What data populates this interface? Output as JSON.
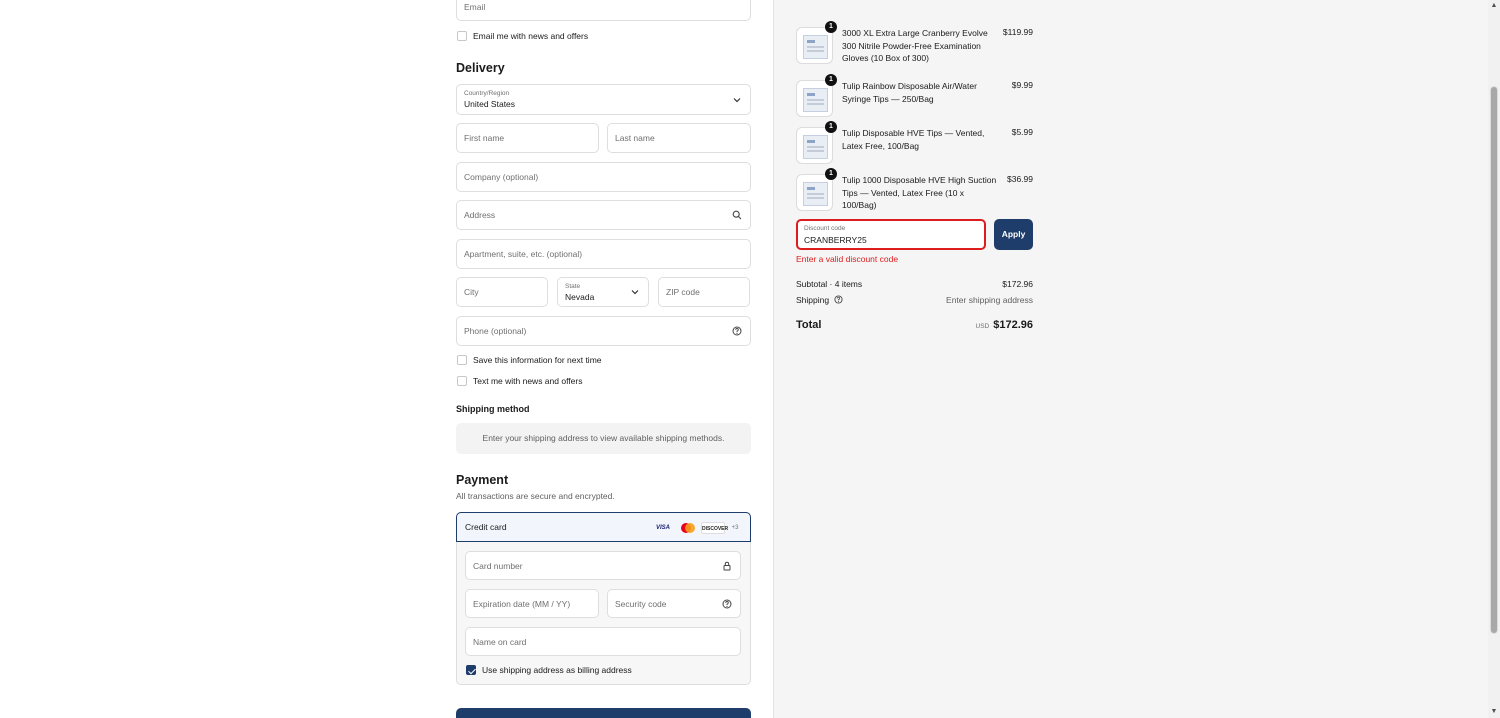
{
  "contact": {
    "email_placeholder": "Email",
    "news_label": "Email me with news and offers"
  },
  "delivery": {
    "heading": "Delivery",
    "country_label": "Country/Region",
    "country_value": "United States",
    "first_name_placeholder": "First name",
    "last_name_placeholder": "Last name",
    "company_placeholder": "Company (optional)",
    "address_placeholder": "Address",
    "apartment_placeholder": "Apartment, suite, etc. (optional)",
    "city_placeholder": "City",
    "state_label": "State",
    "state_value": "Nevada",
    "zip_placeholder": "ZIP code",
    "phone_placeholder": "Phone (optional)",
    "save_info_label": "Save this information for next time",
    "text_news_label": "Text me with news and offers"
  },
  "shipping_method": {
    "heading": "Shipping method",
    "note": "Enter your shipping address to view available shipping methods."
  },
  "payment": {
    "heading": "Payment",
    "subtitle": "All transactions are secure and encrypted.",
    "method_label": "Credit card",
    "card_brands": [
      "VISA",
      "DISCOVER",
      "+3"
    ],
    "card_number_placeholder": "Card number",
    "expiry_placeholder": "Expiration date (MM / YY)",
    "security_placeholder": "Security code",
    "name_placeholder": "Name on card",
    "billing_label": "Use shipping address as billing address",
    "billing_checked": true
  },
  "order": {
    "items": [
      {
        "qty": "1",
        "name": "3000 XL Extra Large Cranberry Evolve 300 Nitrile Powder-Free Examination Gloves (10 Box of 300)",
        "price": "$119.99"
      },
      {
        "qty": "1",
        "name": "Tulip Rainbow Disposable Air/Water Syringe Tips — 250/Bag",
        "price": "$9.99"
      },
      {
        "qty": "1",
        "name": "Tulip Disposable HVE Tips — Vented, Latex Free, 100/Bag",
        "price": "$5.99"
      },
      {
        "qty": "1",
        "name": "Tulip 1000 Disposable HVE High Suction Tips — Vented, Latex Free (10 x 100/Bag)",
        "price": "$36.99"
      }
    ],
    "discount_label": "Discount code",
    "discount_value": "CRANBERRY25",
    "apply_label": "Apply",
    "discount_error": "Enter a valid discount code",
    "subtotal_label": "Subtotal · 4 items",
    "subtotal_value": "$172.96",
    "shipping_label": "Shipping",
    "shipping_value": "Enter shipping address",
    "total_label": "Total",
    "currency": "USD",
    "total_value": "$172.96"
  },
  "colors": {
    "accent": "#1e3d6b",
    "error": "#dd1d1d",
    "sidebar_bg": "#f5f5f5"
  }
}
